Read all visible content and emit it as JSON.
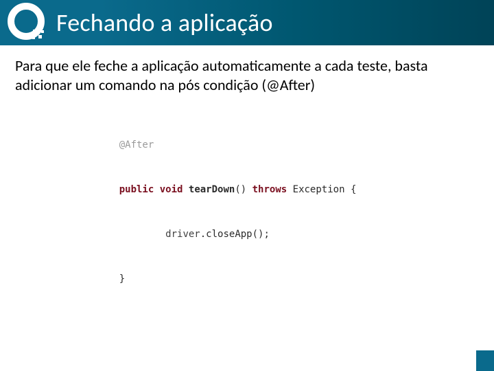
{
  "header": {
    "title": "Fechando a aplicação"
  },
  "body": {
    "paragraph": "Para que ele feche a aplicação automaticamente a cada teste, basta adicionar um comando na pós condição (@After)"
  },
  "code": {
    "annotation": "@After",
    "kw_public": "public",
    "kw_void": "void",
    "fn_name": "tearDown",
    "parens1": "()",
    "kw_throws": "throws",
    "exc": "Exception",
    "brace_open": "{",
    "stmt_indent": "        ",
    "stmt_driver": "driver",
    "stmt_dot": ".",
    "stmt_call": "closeApp();",
    "brace_close": "}"
  }
}
